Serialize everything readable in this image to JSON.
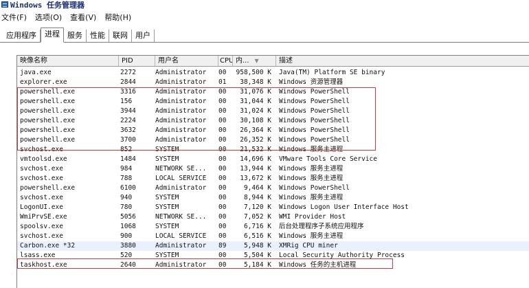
{
  "window": {
    "title": "Windows 任务管理器"
  },
  "menu": [
    "文件(F)",
    "选项(O)",
    "查看(V)",
    "帮助(H)"
  ],
  "tabs": [
    "应用程序",
    "进程",
    "服务",
    "性能",
    "联网",
    "用户"
  ],
  "active_tab": "进程",
  "columns": [
    "映像名称",
    "PID",
    "用户名",
    "CPU",
    "内...",
    "描述"
  ],
  "processes": [
    [
      "java.exe",
      "2272",
      "Administrator",
      "00",
      "958,500 K",
      "Java(TM) Platform SE binary"
    ],
    [
      "explorer.exe",
      "2844",
      "Administrator",
      "01",
      "38,348 K",
      "Windows 资源管理器"
    ],
    [
      "powershell.exe",
      "3316",
      "Administrator",
      "00",
      "31,076 K",
      "Windows PowerShell"
    ],
    [
      "powershell.exe",
      "156",
      "Administrator",
      "00",
      "31,044 K",
      "Windows PowerShell"
    ],
    [
      "powershell.exe",
      "3944",
      "Administrator",
      "00",
      "31,024 K",
      "Windows PowerShell"
    ],
    [
      "powershell.exe",
      "2224",
      "Administrator",
      "00",
      "30,108 K",
      "Windows PowerShell"
    ],
    [
      "powershell.exe",
      "3632",
      "Administrator",
      "00",
      "26,364 K",
      "Windows PowerShell"
    ],
    [
      "powershell.exe",
      "3700",
      "Administrator",
      "00",
      "26,352 K",
      "Windows PowerShell"
    ],
    [
      "svchost.exe",
      "852",
      "SYSTEM",
      "00",
      "21,532 K",
      "Windows 服务主进程"
    ],
    [
      "vmtoolsd.exe",
      "1484",
      "SYSTEM",
      "00",
      "14,696 K",
      "VMware Tools Core Service"
    ],
    [
      "svchost.exe",
      "984",
      "NETWORK SE...",
      "00",
      "13,944 K",
      "Windows 服务主进程"
    ],
    [
      "svchost.exe",
      "788",
      "LOCAL SERVICE",
      "00",
      "13,672 K",
      "Windows 服务主进程"
    ],
    [
      "powershell.exe",
      "6100",
      "Administrator",
      "00",
      "9,464 K",
      "Windows PowerShell"
    ],
    [
      "svchost.exe",
      "940",
      "SYSTEM",
      "00",
      "8,944 K",
      "Windows 服务主进程"
    ],
    [
      "LogonUI.exe",
      "780",
      "SYSTEM",
      "00",
      "7,120 K",
      "Windows Logon User Interface Host"
    ],
    [
      "WmiPrvSE.exe",
      "5056",
      "NETWORK SE...",
      "00",
      "7,052 K",
      "WMI Provider Host"
    ],
    [
      "spoolsv.exe",
      "1068",
      "SYSTEM",
      "00",
      "6,716 K",
      "后台处理程序子系统应用程序"
    ],
    [
      "svchost.exe",
      "900",
      "LOCAL SERVICE",
      "00",
      "6,516 K",
      "Windows 服务主进程"
    ],
    [
      "Carbon.exe *32",
      "3880",
      "Administrator",
      "89",
      "5,948 K",
      "XMRig CPU miner"
    ],
    [
      "lsass.exe",
      "520",
      "SYSTEM",
      "00",
      "5,504 K",
      "Local Security Authority Process"
    ],
    [
      "taskhost.exe",
      "2640",
      "Administrator",
      "00",
      "5,184 K",
      "Windows 任务的主机进程"
    ]
  ],
  "colors": {
    "highlight": "#cc3b3b",
    "selected_row": "#e9f1ff"
  }
}
